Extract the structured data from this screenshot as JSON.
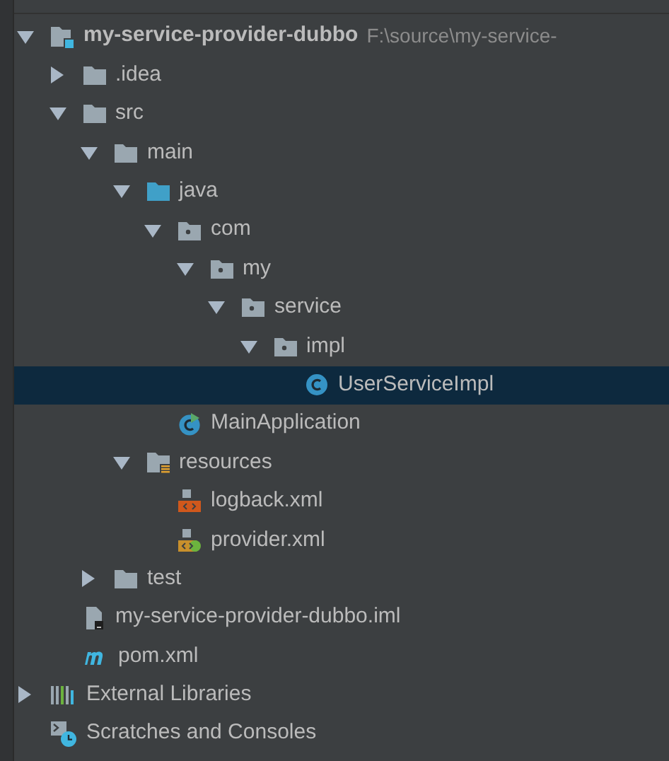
{
  "tree": [
    {
      "kind": "module",
      "label": "my-service-provider-dubbo",
      "path": "F:\\source\\my-service-",
      "expanded": true,
      "selected": false,
      "children": [
        {
          "kind": "folder",
          "label": ".idea",
          "expanded": false,
          "selected": false
        },
        {
          "kind": "folder",
          "label": "src",
          "expanded": true,
          "selected": false,
          "children": [
            {
              "kind": "folder",
              "label": "main",
              "expanded": true,
              "selected": false,
              "children": [
                {
                  "kind": "source-folder",
                  "label": "java",
                  "expanded": true,
                  "selected": false,
                  "children": [
                    {
                      "kind": "package",
                      "label": "com",
                      "expanded": true,
                      "selected": false,
                      "children": [
                        {
                          "kind": "package",
                          "label": "my",
                          "expanded": true,
                          "selected": false,
                          "children": [
                            {
                              "kind": "package",
                              "label": "service",
                              "expanded": true,
                              "selected": false,
                              "children": [
                                {
                                  "kind": "package",
                                  "label": "impl",
                                  "expanded": true,
                                  "selected": false,
                                  "children": [
                                    {
                                      "kind": "class",
                                      "label": "UserServiceImpl",
                                      "selected": true
                                    }
                                  ]
                                }
                              ]
                            }
                          ]
                        }
                      ]
                    },
                    {
                      "kind": "boot-class",
                      "label": "MainApplication",
                      "selected": false
                    }
                  ]
                },
                {
                  "kind": "resources-folder",
                  "label": "resources",
                  "expanded": true,
                  "selected": false,
                  "children": [
                    {
                      "kind": "xml",
                      "label": "logback.xml",
                      "selected": false
                    },
                    {
                      "kind": "spring-xml",
                      "label": "provider.xml",
                      "selected": false
                    }
                  ]
                }
              ]
            },
            {
              "kind": "folder",
              "label": "test",
              "expanded": false,
              "selected": false
            }
          ]
        },
        {
          "kind": "iml",
          "label": "my-service-provider-dubbo.iml",
          "selected": false
        },
        {
          "kind": "maven",
          "label": "pom.xml",
          "selected": false
        }
      ]
    },
    {
      "kind": "libraries",
      "label": "External Libraries",
      "expanded": false,
      "selected": false
    },
    {
      "kind": "scratches",
      "label": "Scratches and Consoles",
      "selected": false
    }
  ]
}
